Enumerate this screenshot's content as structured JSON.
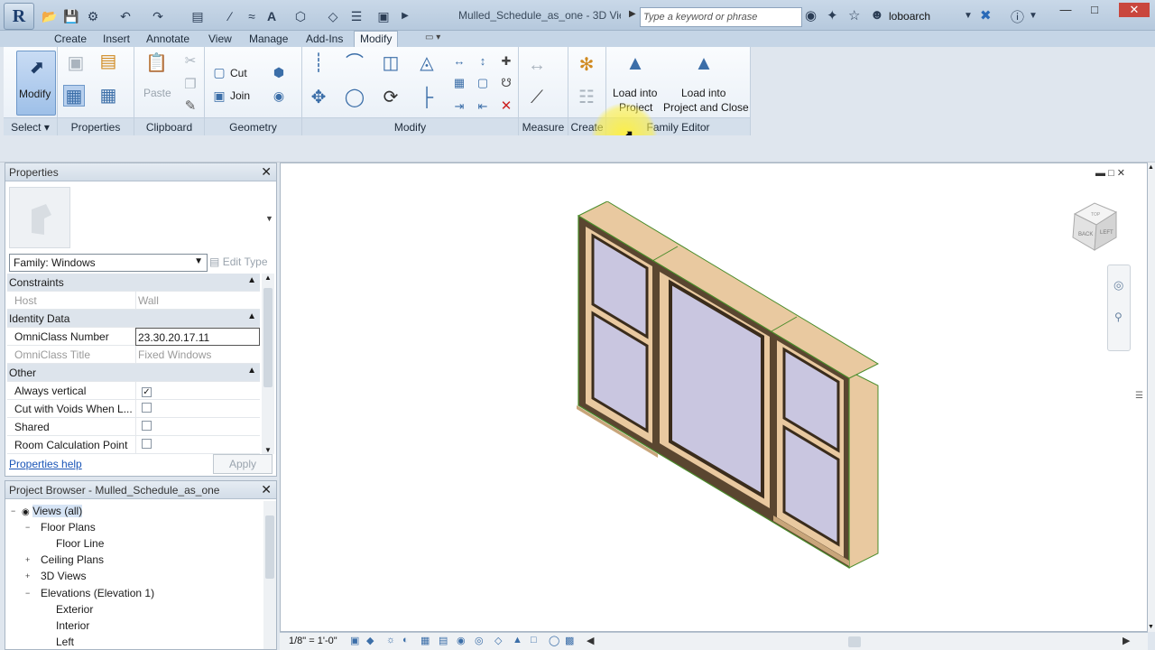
{
  "app": {
    "document_title": "Mulled_Schedule_as_one - 3D Vie...",
    "search_placeholder": "Type a keyword or phrase",
    "user": "loboarch"
  },
  "ribbon": {
    "tabs": [
      {
        "label": "Create"
      },
      {
        "label": "Insert"
      },
      {
        "label": "Annotate"
      },
      {
        "label": "View"
      },
      {
        "label": "Manage"
      },
      {
        "label": "Add-Ins"
      },
      {
        "label": "Modify"
      }
    ],
    "active_tab": "Modify",
    "select_panel": {
      "button": "Modify",
      "label": "Select"
    },
    "properties_panel": {
      "label": "Properties"
    },
    "clipboard_panel": {
      "paste": "Paste",
      "label": "Clipboard"
    },
    "geometry_panel": {
      "cut": "Cut",
      "join": "Join",
      "label": "Geometry"
    },
    "modify_panel": {
      "label": "Modify"
    },
    "measure_panel": {
      "label": "Measure"
    },
    "create_panel": {
      "label": "Create"
    },
    "family_editor_panel": {
      "load_into_project_l1": "Load into",
      "load_into_project_l2": "Project",
      "load_close_l1": "Load into",
      "load_close_l2": "Project and Close",
      "label": "Family Editor"
    }
  },
  "properties": {
    "title": "Properties",
    "family_selector": "Family: Windows",
    "edit_type": "Edit Type",
    "rows": [
      {
        "type": "group",
        "label": "Constraints"
      },
      {
        "type": "row",
        "label": "Host",
        "value": "Wall",
        "disabled": true
      },
      {
        "type": "group",
        "label": "Identity Data"
      },
      {
        "type": "row",
        "label": "OmniClass Number",
        "value": "23.30.20.17.11",
        "editing": true
      },
      {
        "type": "row",
        "label": "OmniClass Title",
        "value": "Fixed Windows",
        "disabled": true
      },
      {
        "type": "group",
        "label": "Other"
      },
      {
        "type": "check",
        "label": "Always vertical",
        "checked": true
      },
      {
        "type": "check",
        "label": "Cut with Voids When L...",
        "checked": false
      },
      {
        "type": "check",
        "label": "Shared",
        "checked": false
      },
      {
        "type": "check",
        "label": "Room Calculation Point",
        "checked": false
      }
    ],
    "help_link": "Properties help",
    "apply": "Apply"
  },
  "project_browser": {
    "title": "Project Browser - Mulled_Schedule_as_one",
    "nodes": [
      {
        "label": "Views (all)",
        "level": 0,
        "toggle": "−"
      },
      {
        "label": "Floor Plans",
        "level": 1,
        "toggle": "−"
      },
      {
        "label": "Floor Line",
        "level": 2,
        "toggle": ""
      },
      {
        "label": "Ceiling Plans",
        "level": 1,
        "toggle": "+"
      },
      {
        "label": "3D Views",
        "level": 1,
        "toggle": "+"
      },
      {
        "label": "Elevations (Elevation 1)",
        "level": 1,
        "toggle": "−"
      },
      {
        "label": "Exterior",
        "level": 2,
        "toggle": ""
      },
      {
        "label": "Interior",
        "level": 2,
        "toggle": ""
      },
      {
        "label": "Left",
        "level": 2,
        "toggle": ""
      }
    ]
  },
  "view": {
    "scale": "1/8\" = 1'-0\"",
    "viewcube_faces": [
      "BACK",
      "LEFT",
      "TOP"
    ]
  },
  "colors": {
    "frame_wood": "#e9c9a0",
    "frame_dark": "#5a4630",
    "glass": "#c9c6e0",
    "edge_green": "#4a8c2a",
    "ribbon_blue": "#3b6ea8"
  }
}
